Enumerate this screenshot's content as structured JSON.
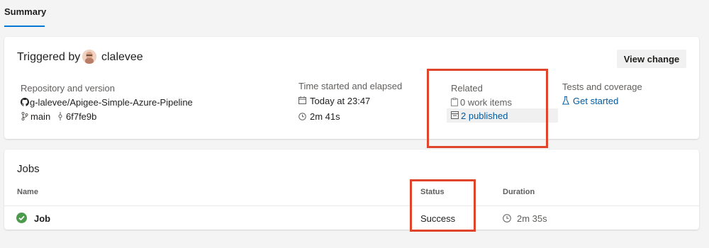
{
  "tabs": [
    {
      "label": "Summary"
    }
  ],
  "summary": {
    "triggered_by_label": "Triggered by",
    "user": "clalevee",
    "view_change_label": "View change",
    "repository": {
      "label": "Repository and version",
      "repo_name": "g-lalevee/Apigee-Simple-Azure-Pipeline",
      "branch": "main",
      "commit": "6f7fe9b"
    },
    "time": {
      "label": "Time started and elapsed",
      "started": "Today at 23:47",
      "elapsed": "2m 41s"
    },
    "related": {
      "label": "Related",
      "work_items": "0 work items",
      "published": "2 published"
    },
    "tests": {
      "label": "Tests and coverage",
      "link": "Get started"
    }
  },
  "jobs": {
    "title": "Jobs",
    "columns": {
      "name": "Name",
      "status": "Status",
      "duration": "Duration"
    },
    "rows": [
      {
        "name": "Job",
        "status": "Success",
        "duration": "2m 35s"
      }
    ]
  },
  "colors": {
    "accent": "#0078d4",
    "link": "#005a9e",
    "success": "#107c10",
    "highlight": "#e0452c"
  },
  "icons": [
    "github-icon",
    "branch-icon",
    "commit-icon",
    "calendar-icon",
    "clock-icon",
    "work-item-icon",
    "artifact-icon",
    "flask-icon",
    "success-check-icon"
  ]
}
